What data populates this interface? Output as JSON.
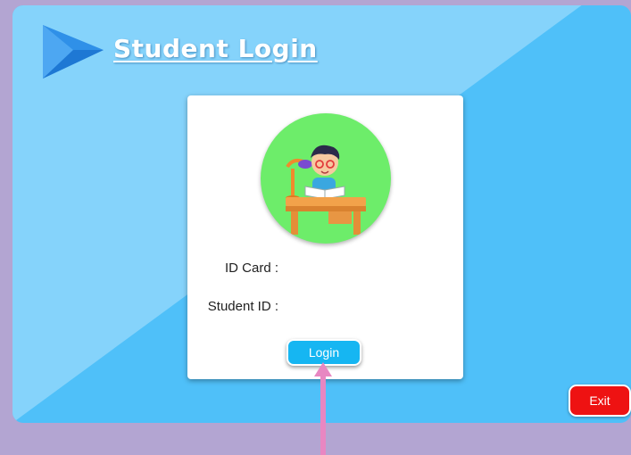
{
  "header": {
    "title": "Student Login",
    "icon": "play-triangle-icon"
  },
  "login_card": {
    "avatar_icon": "student-reading-avatar",
    "fields": [
      {
        "label": "ID Card :",
        "value": ""
      },
      {
        "label": "Student ID :",
        "value": ""
      }
    ],
    "login_label": "Login"
  },
  "footer": {
    "exit_label": "Exit"
  },
  "colors": {
    "background": "#b3a5d2",
    "panel": "#4fc0f9",
    "panel_light": "#85d3fb",
    "login_button": "#16b6f2",
    "exit_button": "#ee1212",
    "avatar_circle": "#6ded6a",
    "arrow": "#e887c2"
  }
}
